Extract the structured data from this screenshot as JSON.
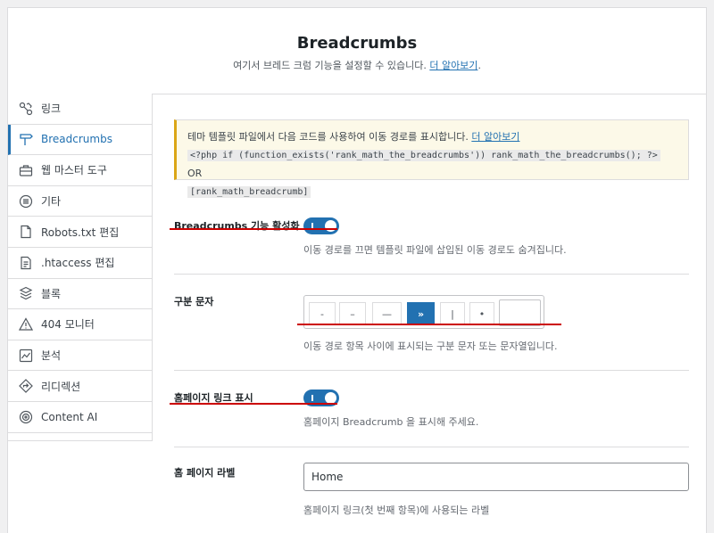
{
  "header": {
    "title": "Breadcrumbs",
    "desc": "여기서 브레드 크럼 기능을 설정할 수 있습니다.",
    "learn_more": "더 알아보기",
    "period": "."
  },
  "sidebar": {
    "items": [
      {
        "label": "링크",
        "icon": "link-icon"
      },
      {
        "label": "Breadcrumbs",
        "icon": "signpost-icon",
        "active": true
      },
      {
        "label": "웹 마스터 도구",
        "icon": "toolbox-icon"
      },
      {
        "label": "기타",
        "icon": "list-circle-icon"
      },
      {
        "label": "Robots.txt 편집",
        "icon": "file-icon"
      },
      {
        "label": ".htaccess 편집",
        "icon": "document-icon"
      },
      {
        "label": "블록",
        "icon": "blocks-icon"
      },
      {
        "label": "404 모니터",
        "icon": "warning-icon"
      },
      {
        "label": "분석",
        "icon": "chart-icon"
      },
      {
        "label": "리디렉션",
        "icon": "redirect-icon"
      },
      {
        "label": "Content AI",
        "icon": "content-ai-icon"
      }
    ]
  },
  "notice": {
    "text": "테마 템플릿 파일에서 다음 코드를 사용하여 이동 경로를 표시합니다.",
    "learn_more": "더 알아보기",
    "code1": "<?php if (function_exists('rank_math_the_breadcrumbs')) rank_math_the_breadcrumbs(); ?>",
    "or": "OR",
    "code2": "[rank_math_breadcrumb]"
  },
  "settings": {
    "enable": {
      "label": "Breadcrumbs 기능 활성화",
      "desc": "이동 경로를 끄면 템플릿 파일에 삽입된 이동 경로도 숨겨집니다.",
      "on": true
    },
    "separator": {
      "label": "구분 문자",
      "options": [
        "-",
        "–",
        "—",
        "»",
        "|",
        "•"
      ],
      "selected": "»",
      "custom_value": "",
      "desc": "이동 경로 항목 사이에 표시되는 구분 문자 또는 문자열입니다."
    },
    "show_home": {
      "label": "홈페이지 링크 표시",
      "desc": "홈페이지 Breadcrumb 을 표시해 주세요.",
      "on": true
    },
    "home_label": {
      "label": "홈 페이지 라벨",
      "value": "Home",
      "desc": "홈페이지 링크(첫 번째 항목)에 사용되는 라벨"
    }
  },
  "colors": {
    "accent": "#2271b1",
    "annotation": "#cc0000",
    "notice_border": "#dba617"
  }
}
